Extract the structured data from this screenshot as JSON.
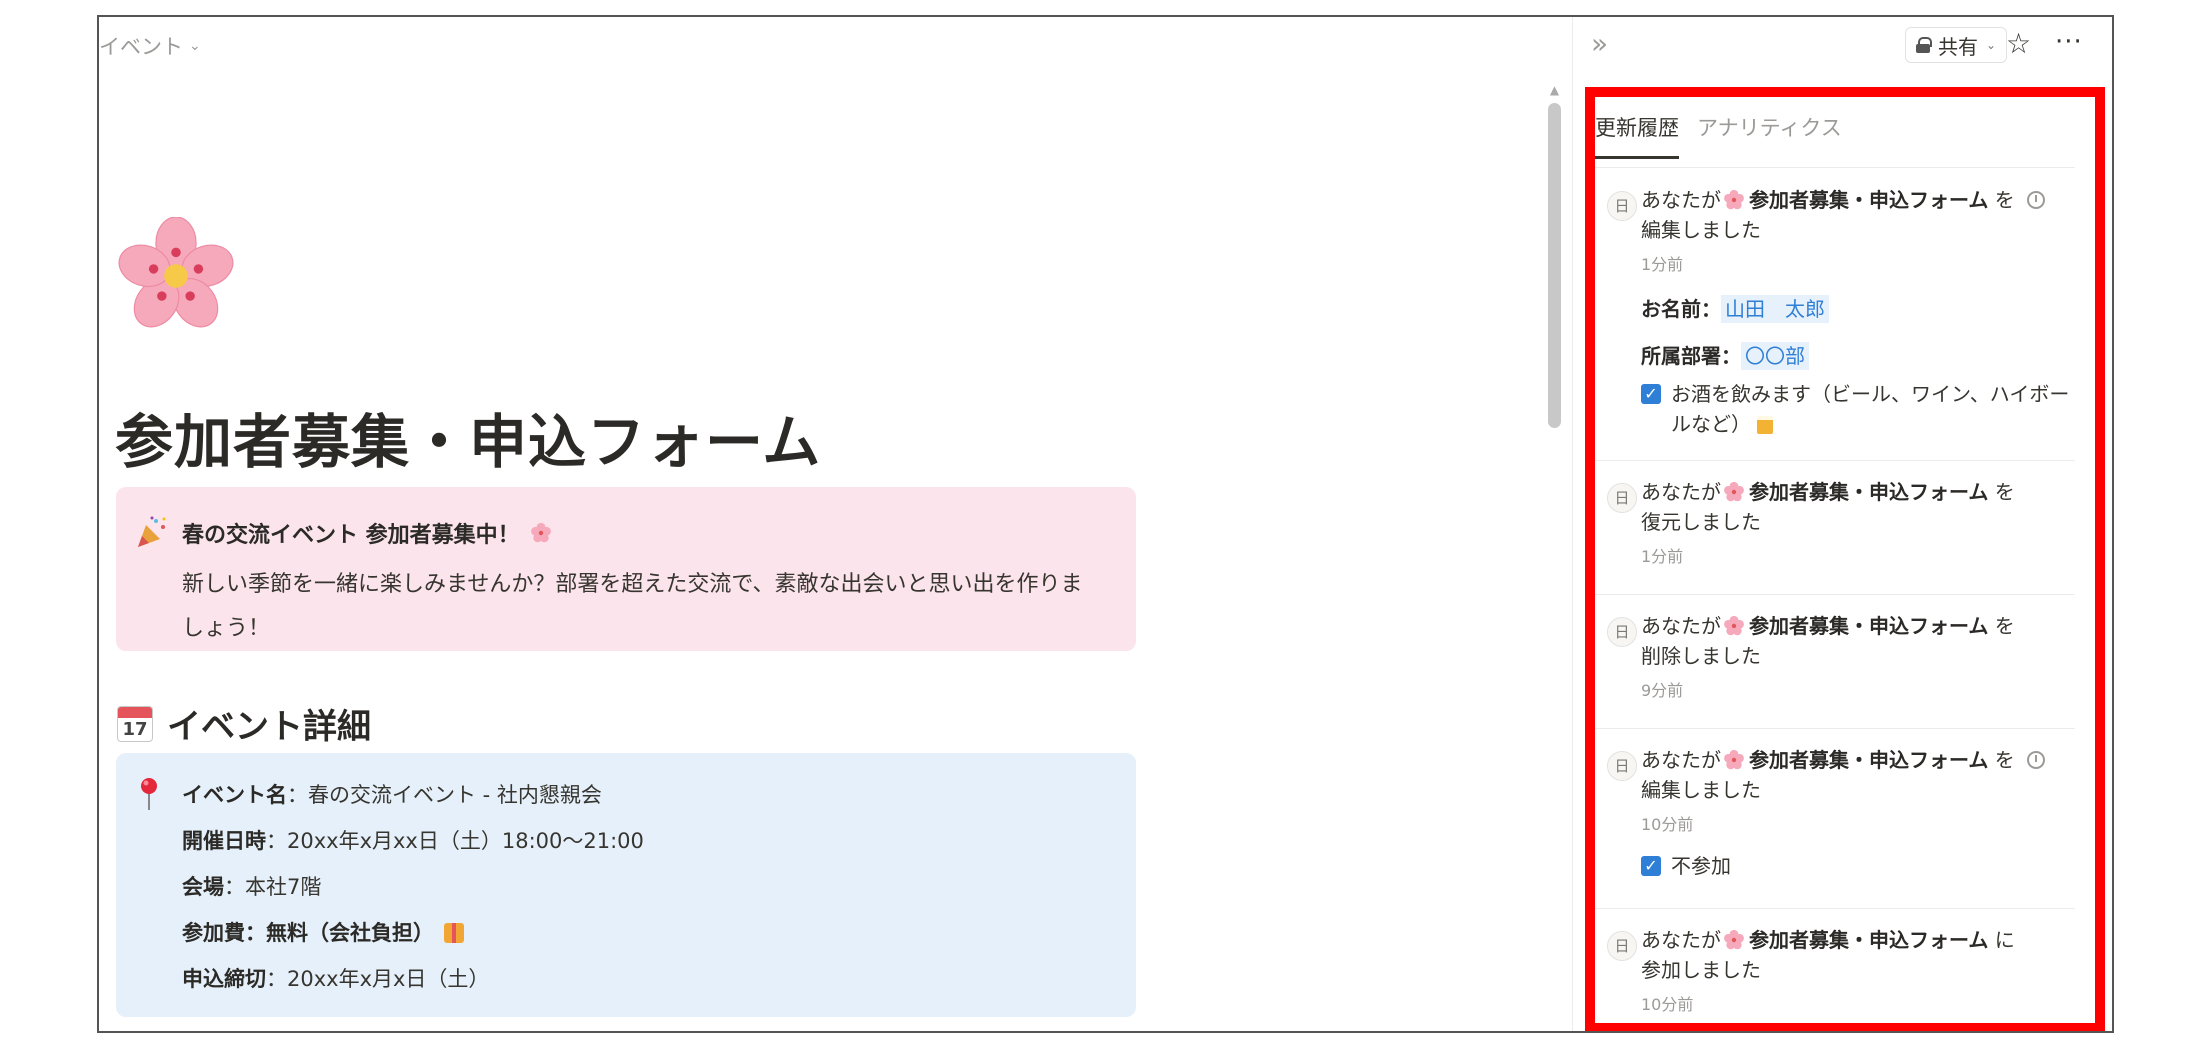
{
  "breadcrumb": {
    "label": "イベント"
  },
  "page": {
    "title": "参加者募集・申込フォーム"
  },
  "callout_pink": {
    "title": "春の交流イベント 参加者募集中！",
    "body": "新しい季節を一緒に楽しみませんか？部署を超えた交流で、素敵な出会いと思い出を作りましょう！"
  },
  "section": {
    "heading": "イベント詳細",
    "calendar_day": "17"
  },
  "details": [
    {
      "key": "イベント名",
      "sep": "：",
      "value": "春の交流イベント - 社内懇親会"
    },
    {
      "key": "開催日時",
      "sep": "：",
      "value": "20xx年x月xx日（土）18:00〜21:00"
    },
    {
      "key": "会場",
      "sep": "：",
      "value": "本社7階"
    },
    {
      "key": "参加費",
      "sep": "：",
      "value": "無料（会社負担）"
    },
    {
      "key": "申込締切",
      "sep": "：",
      "value": "20xx年x月x日（土）"
    }
  ],
  "side": {
    "share_label": "共有",
    "tabs": [
      {
        "label": "更新履歴"
      },
      {
        "label": "アナリティクス"
      }
    ],
    "entries": [
      {
        "avatar": "日",
        "prefix": "あなたが",
        "page": "参加者募集・申込フォーム",
        "action": "を編集しました",
        "time": "1分前"
      },
      {
        "avatar": "日",
        "prefix": "あなたが",
        "page": "参加者募集・申込フォーム",
        "action": "を復元しました",
        "time": "1分前"
      },
      {
        "avatar": "日",
        "prefix": "あなたが",
        "page": "参加者募集・申込フォーム",
        "action": "を削除しました",
        "time": "9分前"
      },
      {
        "avatar": "日",
        "prefix": "あなたが",
        "page": "参加者募集・申込フォーム",
        "action": "を編集しました",
        "time": "10分前"
      },
      {
        "avatar": "日",
        "prefix": "あなたが",
        "page": "参加者募集・申込フォーム",
        "action": "に参加しました",
        "time": "10分前"
      }
    ],
    "entry1_props": [
      {
        "key": "お名前：",
        "value": "山田　太郎"
      },
      {
        "key": "所属部署：",
        "value": "〇〇部"
      }
    ],
    "entry1_check": "お酒を飲みます（ビール、ワイン、ハイボールなど）",
    "entry4_check": "不参加"
  },
  "colors": {
    "accent": "#2f7fd6",
    "highlight": "#ff0000",
    "callout_pink": "#fbe4ec",
    "callout_blue": "#e5f0fa"
  }
}
